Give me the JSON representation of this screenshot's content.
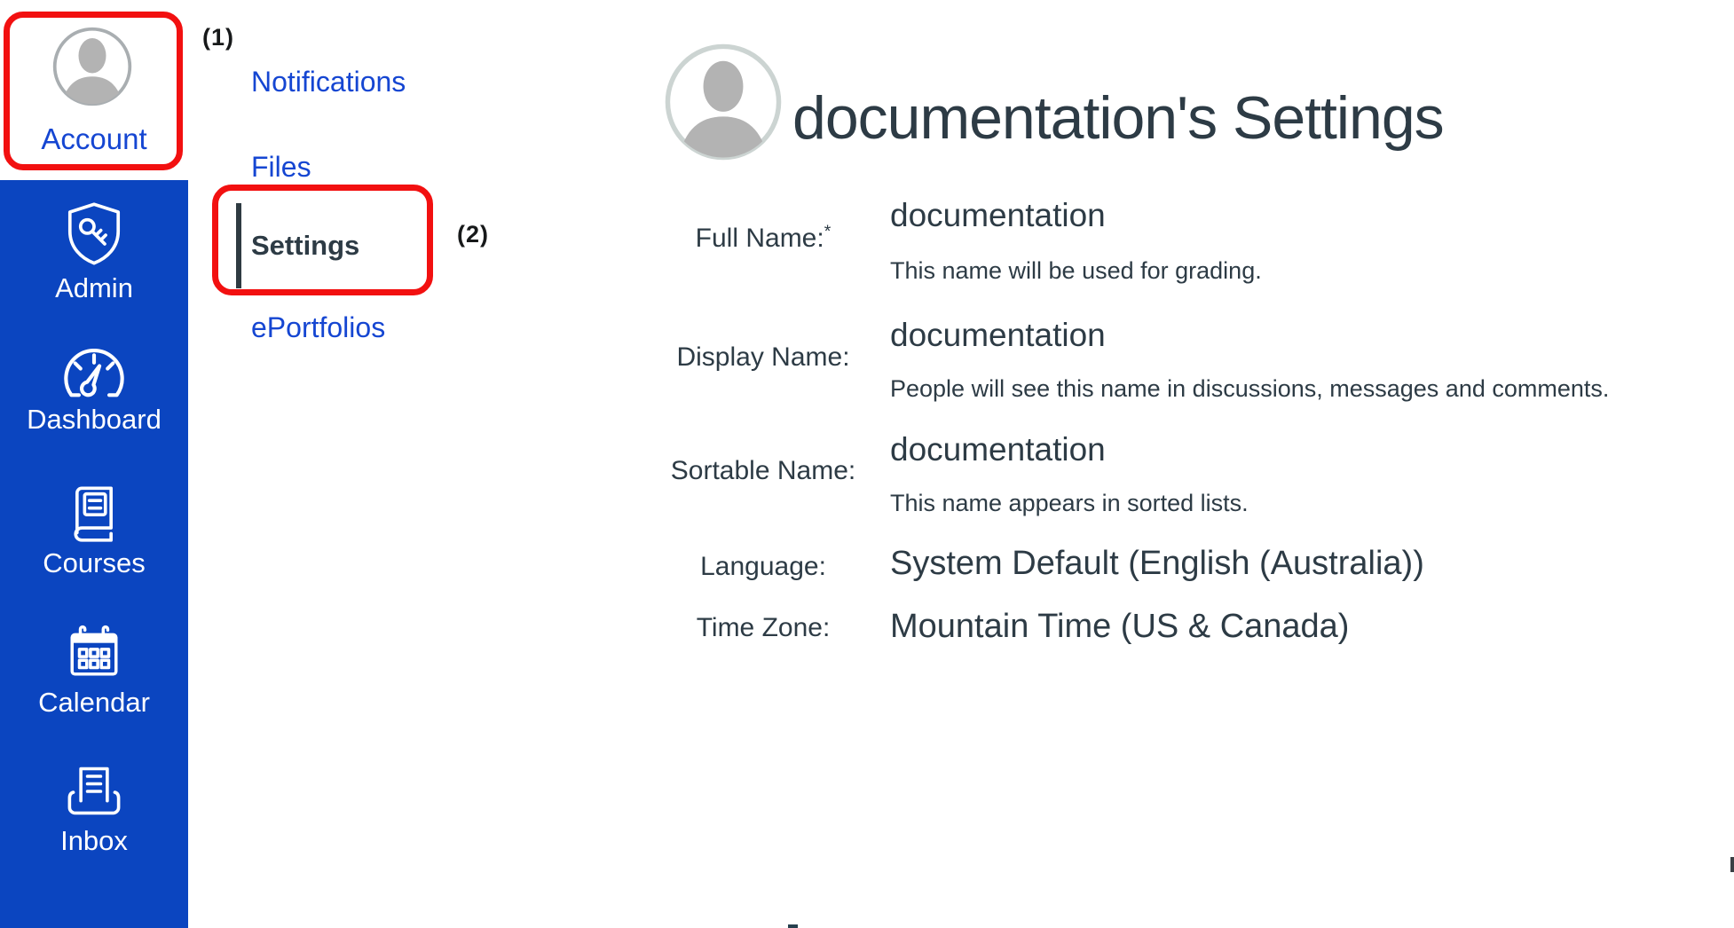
{
  "annotations": {
    "step1": "(1)",
    "step2": "(2)"
  },
  "global_nav": {
    "account": {
      "label": "Account"
    },
    "items": [
      {
        "id": "admin",
        "label": "Admin",
        "icon": "shield-key-icon"
      },
      {
        "id": "dashboard",
        "label": "Dashboard",
        "icon": "gauge-icon"
      },
      {
        "id": "courses",
        "label": "Courses",
        "icon": "book-icon"
      },
      {
        "id": "calendar",
        "label": "Calendar",
        "icon": "calendar-icon"
      },
      {
        "id": "inbox",
        "label": "Inbox",
        "icon": "inbox-tray-icon"
      }
    ]
  },
  "secondary_nav": {
    "items": [
      {
        "label": "Notifications",
        "active": false
      },
      {
        "label": "Files",
        "active": false
      },
      {
        "label": "Settings",
        "active": true
      },
      {
        "label": "ePortfolios",
        "active": false
      }
    ]
  },
  "main": {
    "title": "documentation's Settings",
    "fields": [
      {
        "label": "Full Name:",
        "required": "*",
        "value": "documentation",
        "help": "This name will be used for grading."
      },
      {
        "label": "Display Name:",
        "value": "documentation",
        "help": "People will see this name in discussions, messages and comments."
      },
      {
        "label": "Sortable Name:",
        "value": "documentation",
        "help": "This name appears in sorted lists."
      },
      {
        "label": "Language:",
        "value": "System Default (English (Australia))"
      },
      {
        "label": "Time Zone:",
        "value": "Mountain Time (US & Canada)"
      }
    ]
  },
  "colors": {
    "nav-blue": "#0b45c0",
    "link-blue": "#1546d2",
    "text-dark": "#2d3b45",
    "annotation-red": "#f21010",
    "annotation-text": "#17191a",
    "avatar-gray": "#b3b3b3"
  }
}
